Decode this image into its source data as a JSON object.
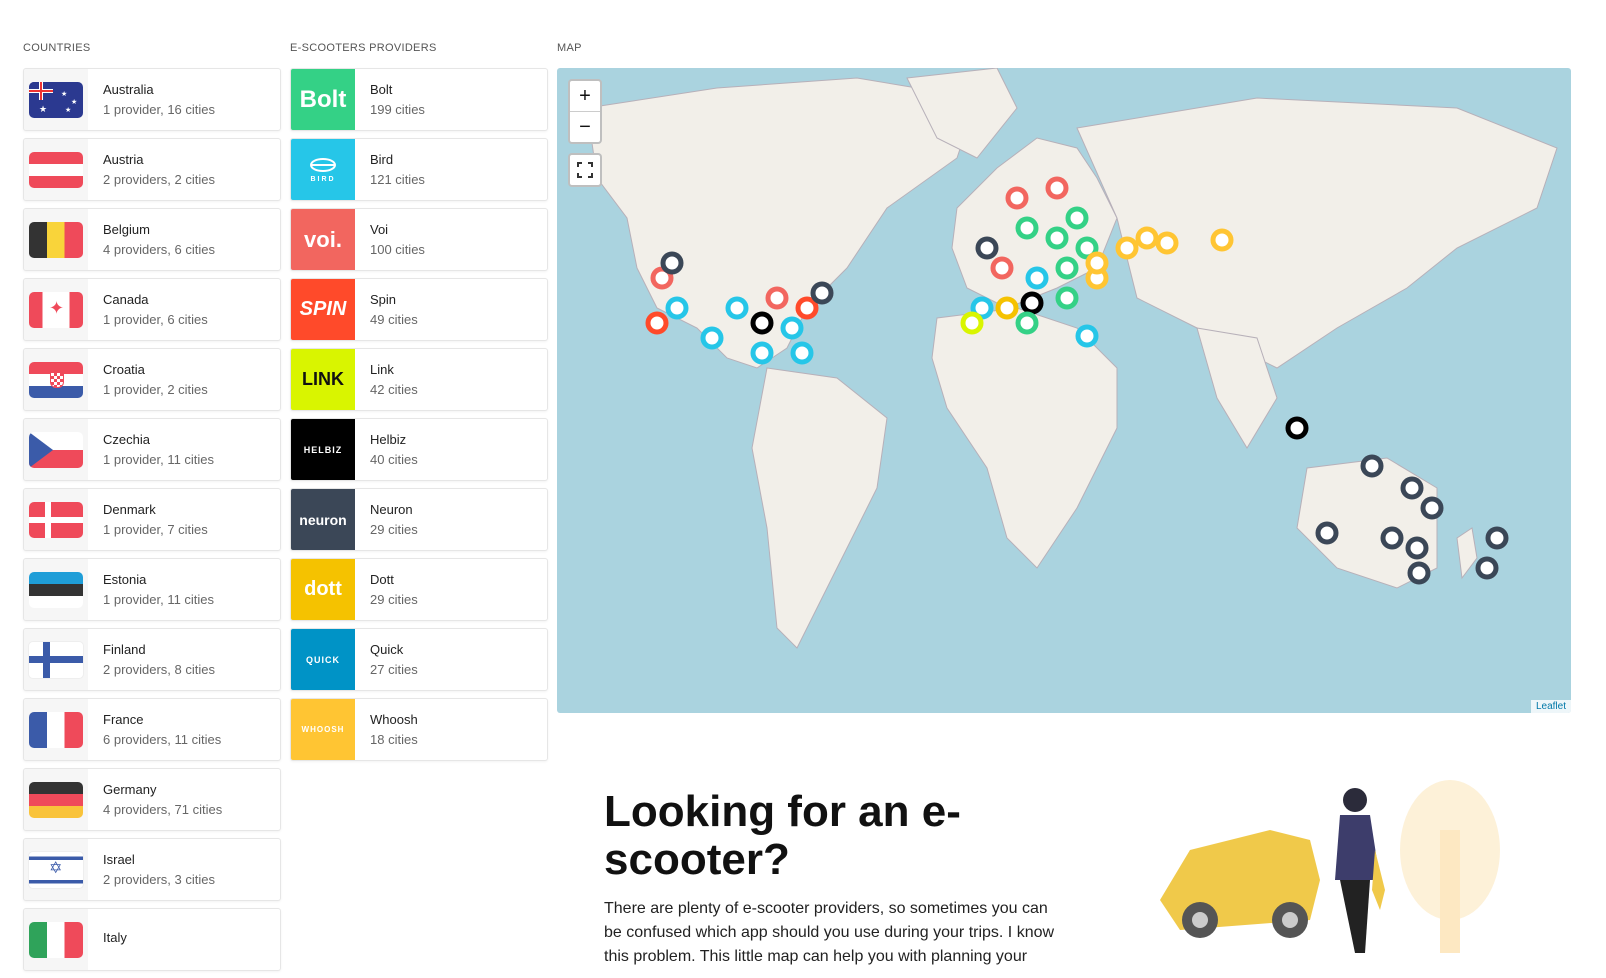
{
  "labels": {
    "countries": "COUNTRIES",
    "providers": "E-SCOOTERS PROVIDERS",
    "map": "MAP"
  },
  "countries": [
    {
      "name": "Australia",
      "info": "1 provider, 16 cities"
    },
    {
      "name": "Austria",
      "info": "2 providers, 2 cities"
    },
    {
      "name": "Belgium",
      "info": "4 providers, 6 cities"
    },
    {
      "name": "Canada",
      "info": "1 provider, 6 cities"
    },
    {
      "name": "Croatia",
      "info": "1 provider, 2 cities"
    },
    {
      "name": "Czechia",
      "info": "1 provider, 11 cities"
    },
    {
      "name": "Denmark",
      "info": "1 provider, 7 cities"
    },
    {
      "name": "Estonia",
      "info": "1 provider, 11 cities"
    },
    {
      "name": "Finland",
      "info": "2 providers, 8 cities"
    },
    {
      "name": "France",
      "info": "6 providers, 11 cities"
    },
    {
      "name": "Germany",
      "info": "4 providers, 71 cities"
    },
    {
      "name": "Israel",
      "info": "2 providers, 3 cities"
    },
    {
      "name": "Italy",
      "info": ""
    }
  ],
  "providers": [
    {
      "name": "Bolt",
      "info": "199 cities",
      "logo": "Bolt",
      "color": "#34d186"
    },
    {
      "name": "Bird",
      "info": "121 cities",
      "logo": "BIRD",
      "color": "#26c6e8"
    },
    {
      "name": "Voi",
      "info": "100 cities",
      "logo": "voi.",
      "color": "#f2665f"
    },
    {
      "name": "Spin",
      "info": "49 cities",
      "logo": "SPIN",
      "color": "#ff4a2a"
    },
    {
      "name": "Link",
      "info": "42 cities",
      "logo": "LINK",
      "color": "#d9f500"
    },
    {
      "name": "Helbiz",
      "info": "40 cities",
      "logo": "HELBIZ",
      "color": "#000000"
    },
    {
      "name": "Neuron",
      "info": "29 cities",
      "logo": "neuron",
      "color": "#3b4757"
    },
    {
      "name": "Dott",
      "info": "29 cities",
      "logo": "dott",
      "color": "#f5c200"
    },
    {
      "name": "Quick",
      "info": "27 cities",
      "logo": "QUICK",
      "color": "#0093c6"
    },
    {
      "name": "Whoosh",
      "info": "18 cities",
      "logo": "WHOOSH",
      "color": "#ffc533"
    }
  ],
  "map": {
    "zoom_in": "+",
    "zoom_out": "−",
    "attribution": "Leaflet"
  },
  "hero": {
    "title": "Looking for an e-scooter?",
    "text": "There are plenty of e-scooter providers, so sometimes you can be confused which app should you use during your trips. I know this problem. This little map can help you with planning your"
  }
}
